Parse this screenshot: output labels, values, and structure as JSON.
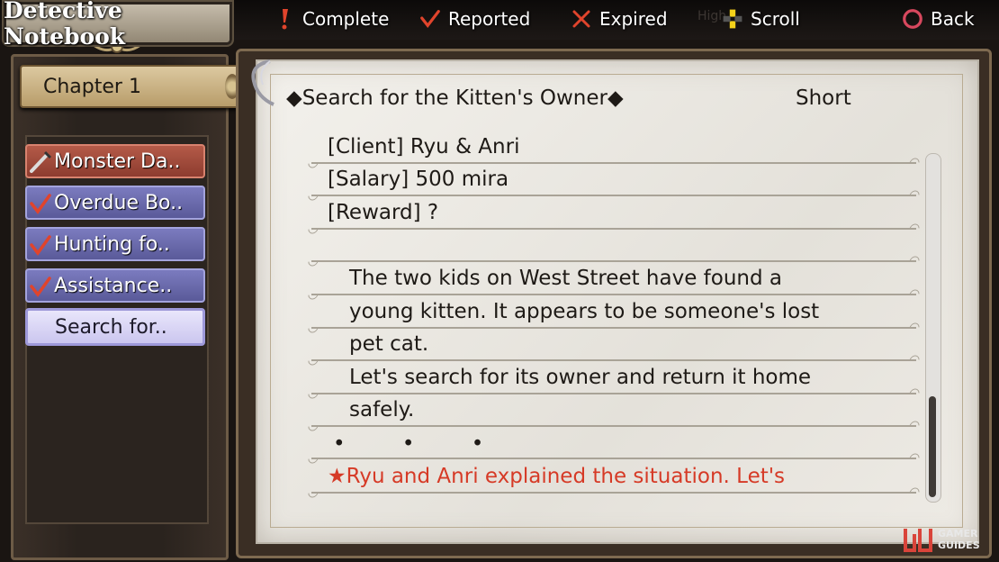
{
  "header": {
    "title": "Detective Notebook",
    "legend": [
      {
        "icon": "exclamation-icon",
        "label": "Complete",
        "color": "#e0442c"
      },
      {
        "icon": "checkmark-icon",
        "label": "Reported",
        "color": "#e0442c"
      },
      {
        "icon": "x-icon",
        "label": "Expired",
        "color": "#e0442c"
      },
      {
        "icon": "dpad-icon",
        "label": "Scroll",
        "color": "#f5d21a"
      },
      {
        "icon": "circle-button-icon",
        "label": "Back",
        "color": "#d8485e"
      }
    ],
    "hint": "High"
  },
  "sidebar": {
    "chapter": "Chapter 1",
    "quests": [
      {
        "label": "Monster Da..",
        "status": "in-progress",
        "icon": "quill-icon"
      },
      {
        "label": "Overdue Bo..",
        "status": "reported",
        "icon": "checkmark-icon"
      },
      {
        "label": "Hunting fo..",
        "status": "reported",
        "icon": "checkmark-icon"
      },
      {
        "label": "Assistance..",
        "status": "reported",
        "icon": "checkmark-icon"
      },
      {
        "label": "Search for..",
        "status": "selected",
        "icon": ""
      }
    ]
  },
  "detail": {
    "title": "◆Search for the Kitten's Owner◆",
    "length": "Short",
    "client": "[Client]  Ryu & Anri",
    "salary": "[Salary] 500 mira",
    "reward": "[Reward] ?",
    "description": [
      "The two kids on West Street have found a",
      "young kitten. It appears to be someone's lost",
      "pet cat.",
      "Let's search for its owner and return it home",
      "safely."
    ],
    "ellipsis": "• • •",
    "progress_note": "★Ryu and Anri explained the situation. Let's"
  },
  "watermark": {
    "line1": "GAMER",
    "line2": "GUIDES"
  }
}
